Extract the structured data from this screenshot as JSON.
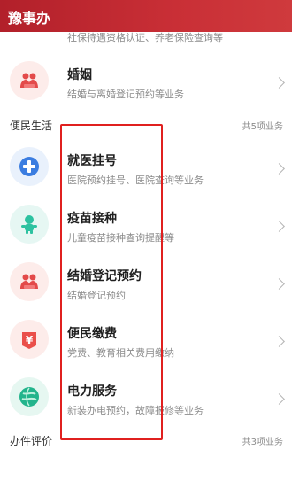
{
  "app": {
    "title": "豫事办"
  },
  "partial_item": {
    "subtitle": "社保待遇资格认证、养老保险查询等"
  },
  "top_items": [
    {
      "title": "婚姻",
      "subtitle": "结婚与离婚登记预约等业务",
      "icon": "marriage-icon",
      "icon_bg": "#fdecea"
    }
  ],
  "sections": {
    "convenience": {
      "label": "便民生活",
      "count": "共5项业务"
    },
    "evaluation": {
      "label": "办件评价",
      "count": "共3项业务"
    }
  },
  "convenience_items": [
    {
      "title": "就医挂号",
      "subtitle": "医院预约挂号、医院查询等业务",
      "icon": "medical-cross-icon",
      "icon_bg": "#e9f1fc"
    },
    {
      "title": "疫苗接种",
      "subtitle": "儿童疫苗接种查询提醒等",
      "icon": "baby-icon",
      "icon_bg": "#e6f7f3"
    },
    {
      "title": "结婚登记预约",
      "subtitle": "结婚登记预约",
      "icon": "marriage-icon",
      "icon_bg": "#fdecea"
    },
    {
      "title": "便民缴费",
      "subtitle": "党费、教育相关费用缴纳",
      "icon": "yuan-icon",
      "icon_bg": "#fdecea"
    },
    {
      "title": "电力服务",
      "subtitle": "新装办电预约，故障报修等业务",
      "icon": "power-globe-icon",
      "icon_bg": "#e6f7f1"
    }
  ],
  "colors": {
    "accent": "#c62a33",
    "highlight": "#e0201f"
  }
}
